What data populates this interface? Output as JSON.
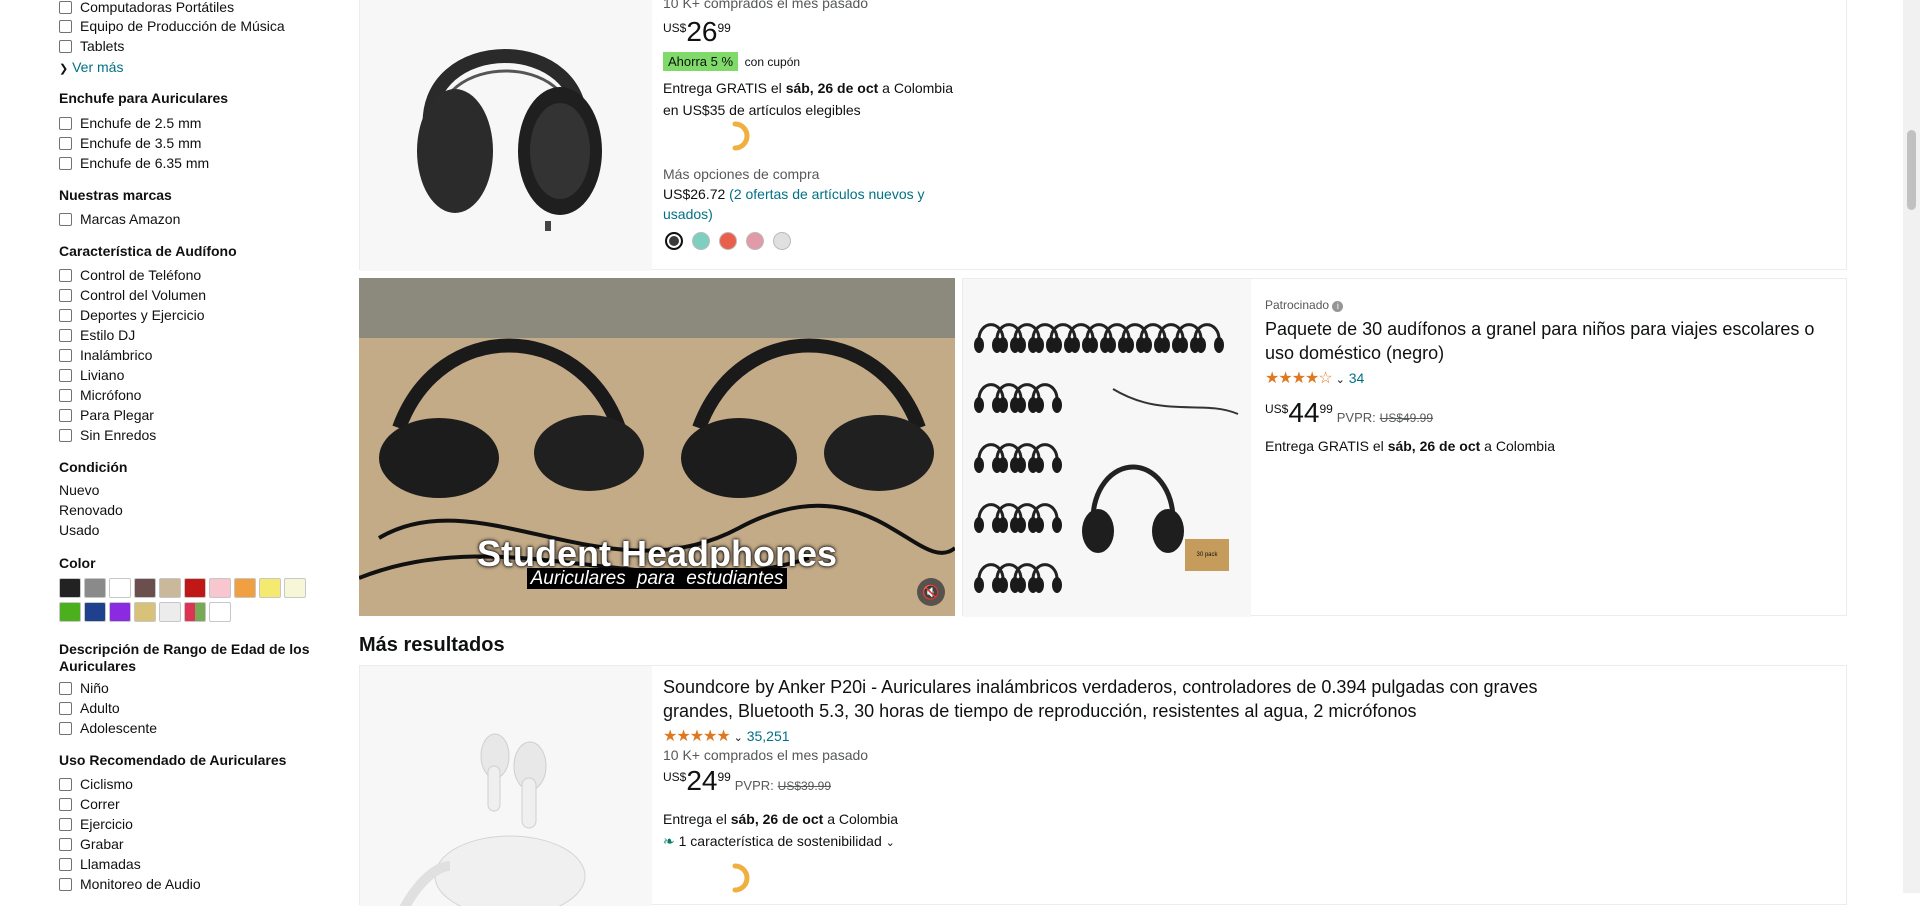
{
  "sidebar": {
    "category_items": [
      "Computadoras Portátiles",
      "Equipo de Producción de Música",
      "Tablets"
    ],
    "see_more": "Ver más",
    "plug": {
      "title": "Enchufe para Auriculares",
      "items": [
        "Enchufe de 2.5 mm",
        "Enchufe de 3.5 mm",
        "Enchufe de 6.35 mm"
      ]
    },
    "brands": {
      "title": "Nuestras marcas",
      "items": [
        "Marcas Amazon"
      ]
    },
    "features": {
      "title": "Característica de Audífono",
      "items": [
        "Control de Teléfono",
        "Control del Volumen",
        "Deportes y Ejercicio",
        "Estilo DJ",
        "Inalámbrico",
        "Liviano",
        "Micrófono",
        "Para Plegar",
        "Sin Enredos"
      ]
    },
    "condition": {
      "title": "Condición",
      "items": [
        "Nuevo",
        "Renovado",
        "Usado"
      ]
    },
    "color": {
      "title": "Color",
      "swatches": [
        "#222222",
        "#8a8a8a",
        "#ffffff",
        "#6b4f4f",
        "#c9b99a",
        "#c01717",
        "#f7c6cf",
        "#f0a040",
        "#f5ea70",
        "#f7f7d8",
        "#4caf1e",
        "#1f3f8f",
        "#8a2be2",
        "#d8c27a",
        "#ececec",
        "#multi",
        "#ffffff"
      ]
    },
    "age": {
      "title": "Descripción de Rango de Edad de los Auriculares",
      "items": [
        "Niño",
        "Adulto",
        "Adolescente"
      ]
    },
    "usage": {
      "title": "Uso Recomendado de Auriculares",
      "items": [
        "Ciclismo",
        "Correr",
        "Ejercicio",
        "Grabar",
        "Llamadas",
        "Monitoreo de Audio"
      ]
    }
  },
  "product1": {
    "bought": "10 K+ comprados el mes pasado",
    "currency": "US$",
    "price_whole": "26",
    "price_frac": "99",
    "coupon_badge": "Ahorra 5 %",
    "coupon_text": "con cupón",
    "delivery_line1_a": "Entrega GRATIS el ",
    "delivery_line1_b": "sáb, 26 de oct",
    "delivery_line1_c": " a Colombia",
    "delivery_line2": "en US$35 de artículos elegibles",
    "more_options": "Más opciones de compra",
    "alt_price": "US$26.72",
    "offers_link": "(2 ofertas de artículos nuevos y usados)",
    "colors": [
      "#3a3a3a",
      "#7fcfc0",
      "#e8604c",
      "#e09aa8",
      "#e0e0e0"
    ]
  },
  "video": {
    "title": "Student Headphones",
    "subtitle": "Auriculares para estudiantes"
  },
  "sponsored": {
    "label": "Patrocinado",
    "title": "Paquete de 30 audífonos a granel para niños para viajes escolares o uso doméstico (negro)",
    "rating": 3.5,
    "reviews": "34",
    "currency": "US$",
    "price_whole": "44",
    "price_frac": "99",
    "list_label": "PVPR:",
    "list_price": "US$49.99",
    "delivery_a": "Entrega GRATIS el ",
    "delivery_b": "sáb, 26 de oct",
    "delivery_c": " a Colombia",
    "box_label": "30 pack"
  },
  "more_results": "Más resultados",
  "product2": {
    "title": "Soundcore by Anker P20i - Auriculares inalámbricos verdaderos, controladores de 0.394 pulgadas con graves grandes, Bluetooth 5.3, 30 horas de tiempo de reproducción, resistentes al agua, 2 micrófonos",
    "rating": 4.5,
    "reviews": "35,251",
    "bought": "10 K+ comprados el mes pasado",
    "currency": "US$",
    "price_whole": "24",
    "price_frac": "99",
    "list_label": "PVPR:",
    "list_price": "US$39.99",
    "delivery_a": "Entrega el ",
    "delivery_b": "sáb, 26 de oct",
    "delivery_c": " a Colombia",
    "sustainability": "1 característica de sostenibilidad"
  }
}
